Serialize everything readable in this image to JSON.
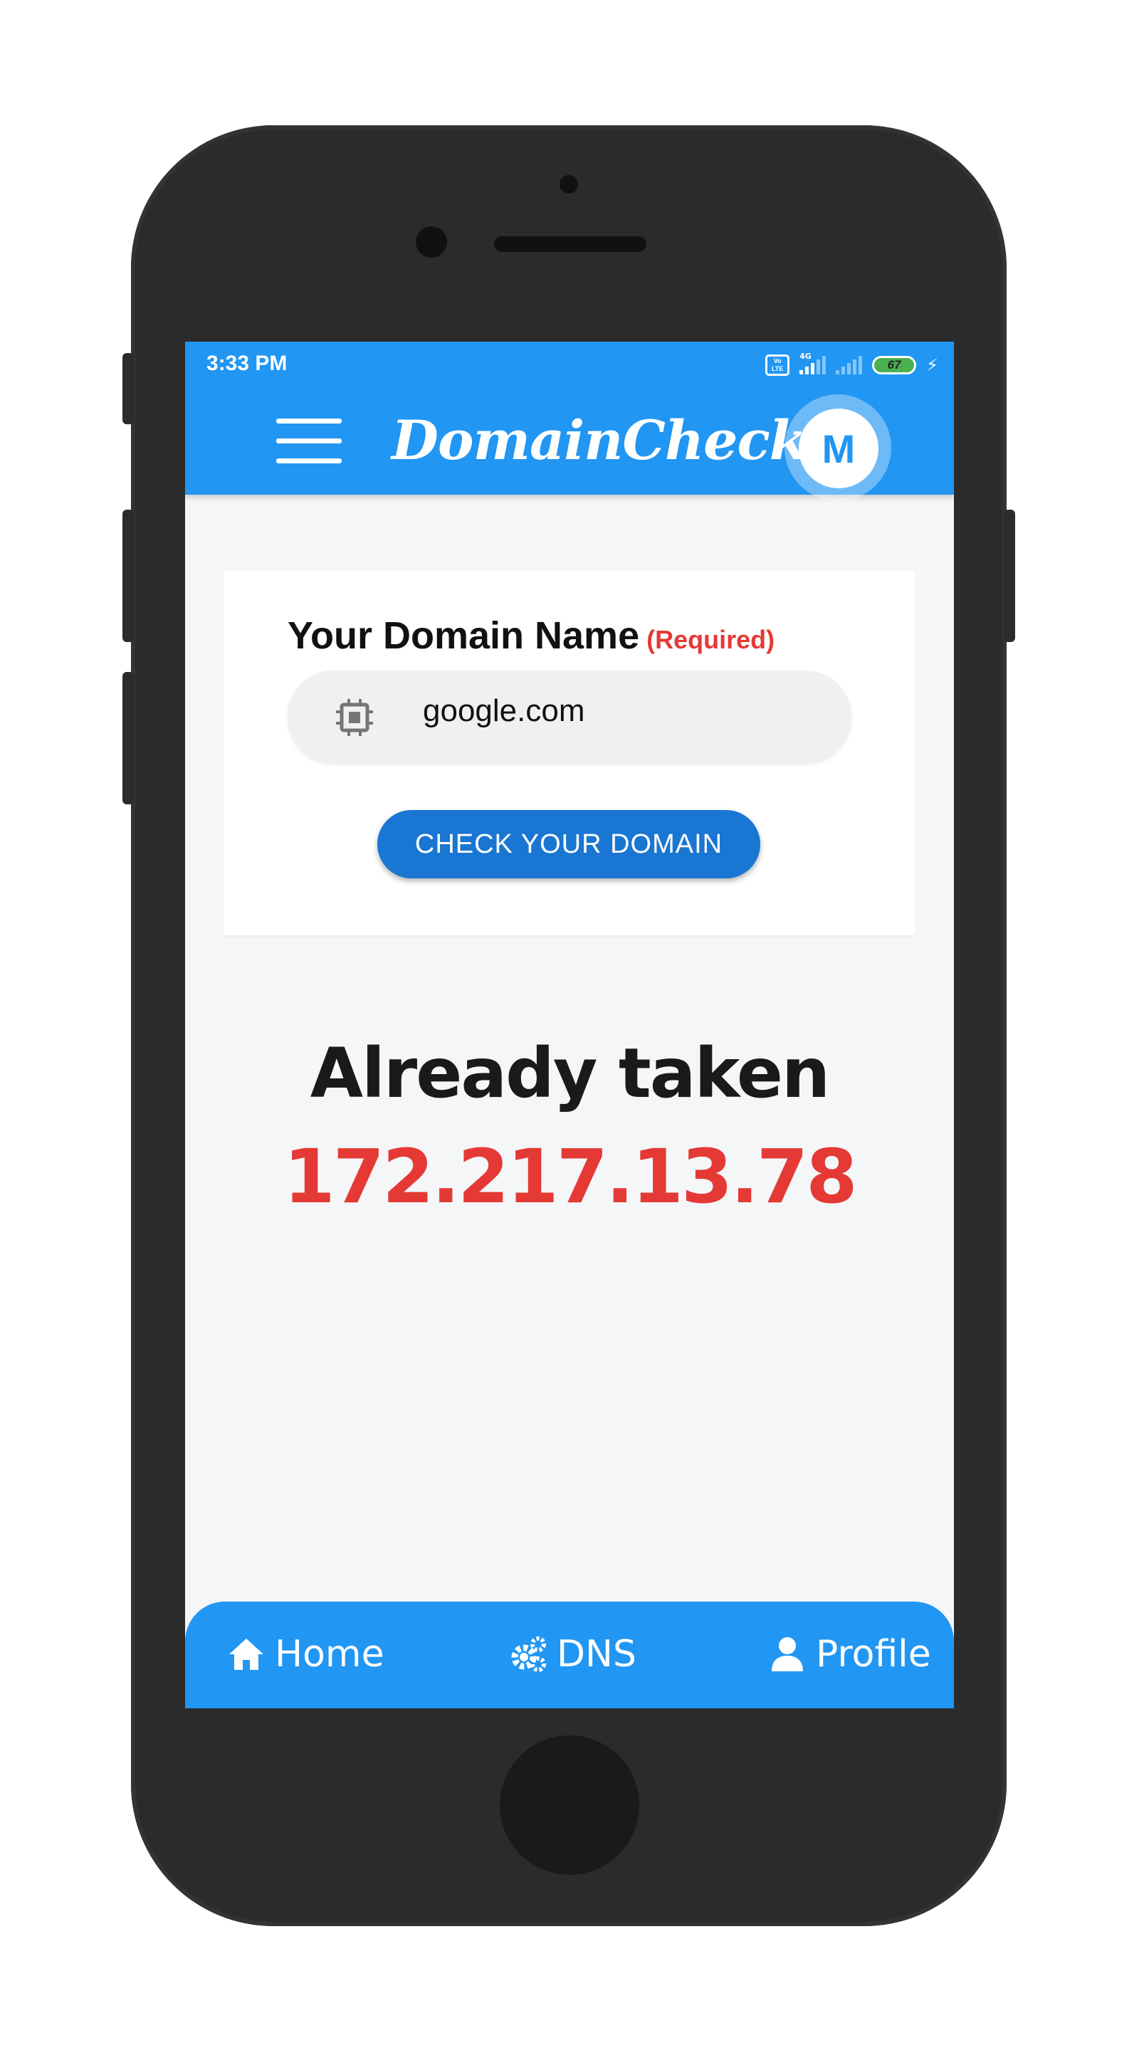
{
  "status_bar": {
    "time": "3:33 PM",
    "volte_label": "Vo LTE",
    "network_label": "4G",
    "battery_level": "67"
  },
  "app_bar": {
    "title": "DomainChecker",
    "avatar_initial": "M"
  },
  "form": {
    "label": "Your Domain Name",
    "required_text": "(Required)",
    "domain_value": "google.com",
    "check_button": "CHECK YOUR DOMAIN"
  },
  "result": {
    "status": "Already taken",
    "ip": "172.217.13.78"
  },
  "bottom_nav": {
    "items": [
      {
        "label": "Home",
        "icon": "home-icon"
      },
      {
        "label": "DNS",
        "icon": "gears-icon"
      },
      {
        "label": "Profile",
        "icon": "user-icon"
      }
    ]
  },
  "colors": {
    "primary": "#2196f3",
    "button": "#1976d2",
    "error_red": "#e53935",
    "background": "#f4f6f8",
    "phone_body": "#2b2b2b"
  }
}
